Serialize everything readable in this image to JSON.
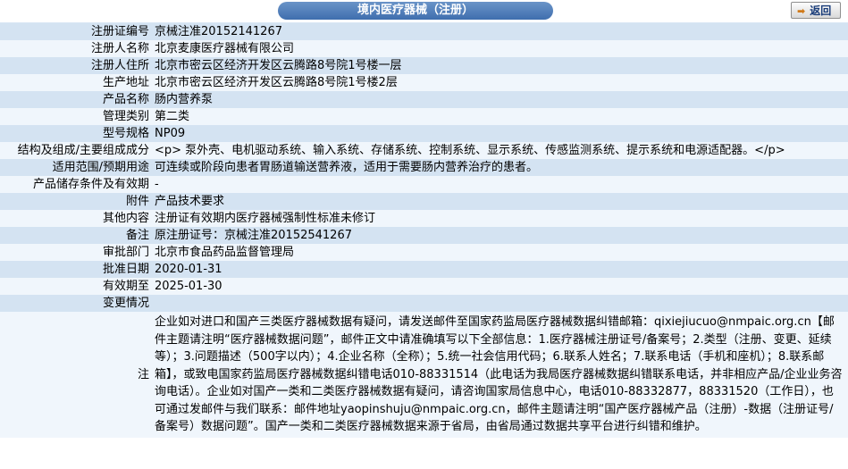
{
  "header": {
    "title": "境内医疗器械（注册）",
    "back_label": "返回",
    "back_icon": "arrow-right-icon"
  },
  "rows": [
    {
      "label": "注册证编号",
      "value": "京械注准20152141267"
    },
    {
      "label": "注册人名称",
      "value": "北京麦康医疗器械有限公司"
    },
    {
      "label": "注册人住所",
      "value": "北京市密云区经济开发区云腾路8号院1号楼一层"
    },
    {
      "label": "生产地址",
      "value": "北京市密云区经济开发区云腾路8号院1号楼2层"
    },
    {
      "label": "产品名称",
      "value": "肠内营养泵"
    },
    {
      "label": "管理类别",
      "value": "第二类"
    },
    {
      "label": "型号规格",
      "value": "NP09"
    },
    {
      "label": "结构及组成/主要组成成分",
      "value": "<p> 泵外壳、电机驱动系统、输入系统、存储系统、控制系统、显示系统、传感监测系统、提示系统和电源适配器。</p>"
    },
    {
      "label": "适用范围/预期用途",
      "value": "可连续或阶段向患者胃肠道输送营养液，适用于需要肠内营养治疗的患者。"
    },
    {
      "label": "产品储存条件及有效期",
      "value": "-"
    },
    {
      "label": "附件",
      "value": "产品技术要求"
    },
    {
      "label": "其他内容",
      "value": "注册证有效期内医疗器械强制性标准未修订"
    },
    {
      "label": "备注",
      "value": "原注册证号：京械注准20152541267"
    },
    {
      "label": "审批部门",
      "value": "北京市食品药品监督管理局"
    },
    {
      "label": "批准日期",
      "value": "2020-01-31"
    },
    {
      "label": "有效期至",
      "value": "2025-01-30"
    },
    {
      "label": "变更情况",
      "value": ""
    }
  ],
  "note": {
    "label": "注",
    "text": "企业如对进口和国产三类医疗器械数据有疑问，请发送邮件至国家药监局医疗器械数据纠错邮箱：qixiejiucuo@nmpaic.org.cn【邮件主题请注明“医疗器械数据问题”，邮件正文中请准确填写以下全部信息：1.医疗器械注册证号/备案号；2.类型（注册、变更、延续等）；3.问题描述（500字以内）；4.企业名称（全称）；5.统一社会信用代码；6.联系人姓名；7.联系电话（手机和座机）；8.联系邮箱】，或致电国家药监局医疗器械数据纠错电话010-88331514（此电话为我局医疗器械数据纠错联系电话，并非相应产品/企业业务咨询电话）。企业如对国产一类和二类医疗器械数据有疑问，请咨询国家局信息中心，电话010-88332877，88331520（工作日），也可通过发邮件与我们联系：邮件地址yaopinshuju@nmpaic.org.cn，邮件主题请注明“国产医疗器械产品（注册）-数据（注册证号/备案号）数据问题”。国产一类和二类医疗器械数据来源于省局，由省局通过数据共享平台进行纠错和维护。"
  }
}
